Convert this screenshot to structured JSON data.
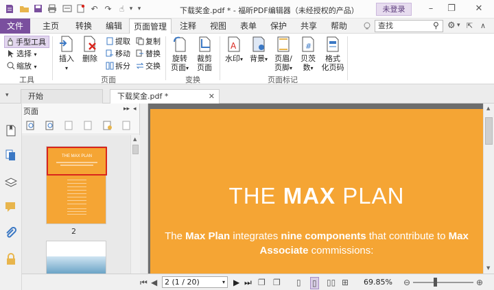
{
  "titlebar": {
    "title": "下载奖金.pdf * - 福昕PDF编辑器（未经授权的产品）",
    "login_label": "未登录",
    "quick_access_icons": [
      "folder-open-icon",
      "save-icon",
      "print-icon",
      "new-icon",
      "undo-icon",
      "redo-icon",
      "hand-icon",
      "customize-icon"
    ],
    "window_buttons": [
      "minimize",
      "restore",
      "close"
    ]
  },
  "menu": {
    "tabs": [
      "文件",
      "主页",
      "转换",
      "编辑",
      "页面管理",
      "注释",
      "视图",
      "表单",
      "保护",
      "共享",
      "帮助"
    ],
    "active": "页面管理",
    "search_placeholder": "查找"
  },
  "ribbon": {
    "tools": {
      "hand": "手型工具",
      "select": "选择",
      "zoom": "缩放",
      "group": "工具"
    },
    "insert": "插入",
    "delete": "删除",
    "extract": "提取",
    "move": "移动",
    "split": "拆分",
    "copy": "复制",
    "replace": "替换",
    "swap": "交换",
    "pages_group": "页面",
    "rotate": [
      "旋转",
      "页面"
    ],
    "crop": [
      "裁剪",
      "页面"
    ],
    "transform_group": "变换",
    "watermark": "水印",
    "background": "背景",
    "header_footer": [
      "页眉/",
      "页脚"
    ],
    "bates": [
      "贝茨",
      "数"
    ],
    "format_page_number": [
      "格式",
      "化页码"
    ],
    "page_marks_group": "页面标记"
  },
  "doc_tabs": {
    "start": "开始",
    "document": "下载奖金.pdf *"
  },
  "pages_panel": {
    "title": "页面",
    "thumb_page_number": "2",
    "thumb_title": "THE MAX PLAN"
  },
  "document": {
    "title_prefix": "THE ",
    "title_bold": "MAX",
    "title_suffix": " PLAN",
    "body_parts": [
      "The ",
      "Max Plan",
      " integrates ",
      "nine components",
      " that contribute to ",
      "Max Associate",
      " commissions:"
    ],
    "page_color": "#f5a534"
  },
  "status": {
    "page_indicator": "2 (1 / 20)",
    "zoom": "69.85%"
  },
  "colors": {
    "brand": "#7a4f9e",
    "selection": "#d9251c"
  }
}
